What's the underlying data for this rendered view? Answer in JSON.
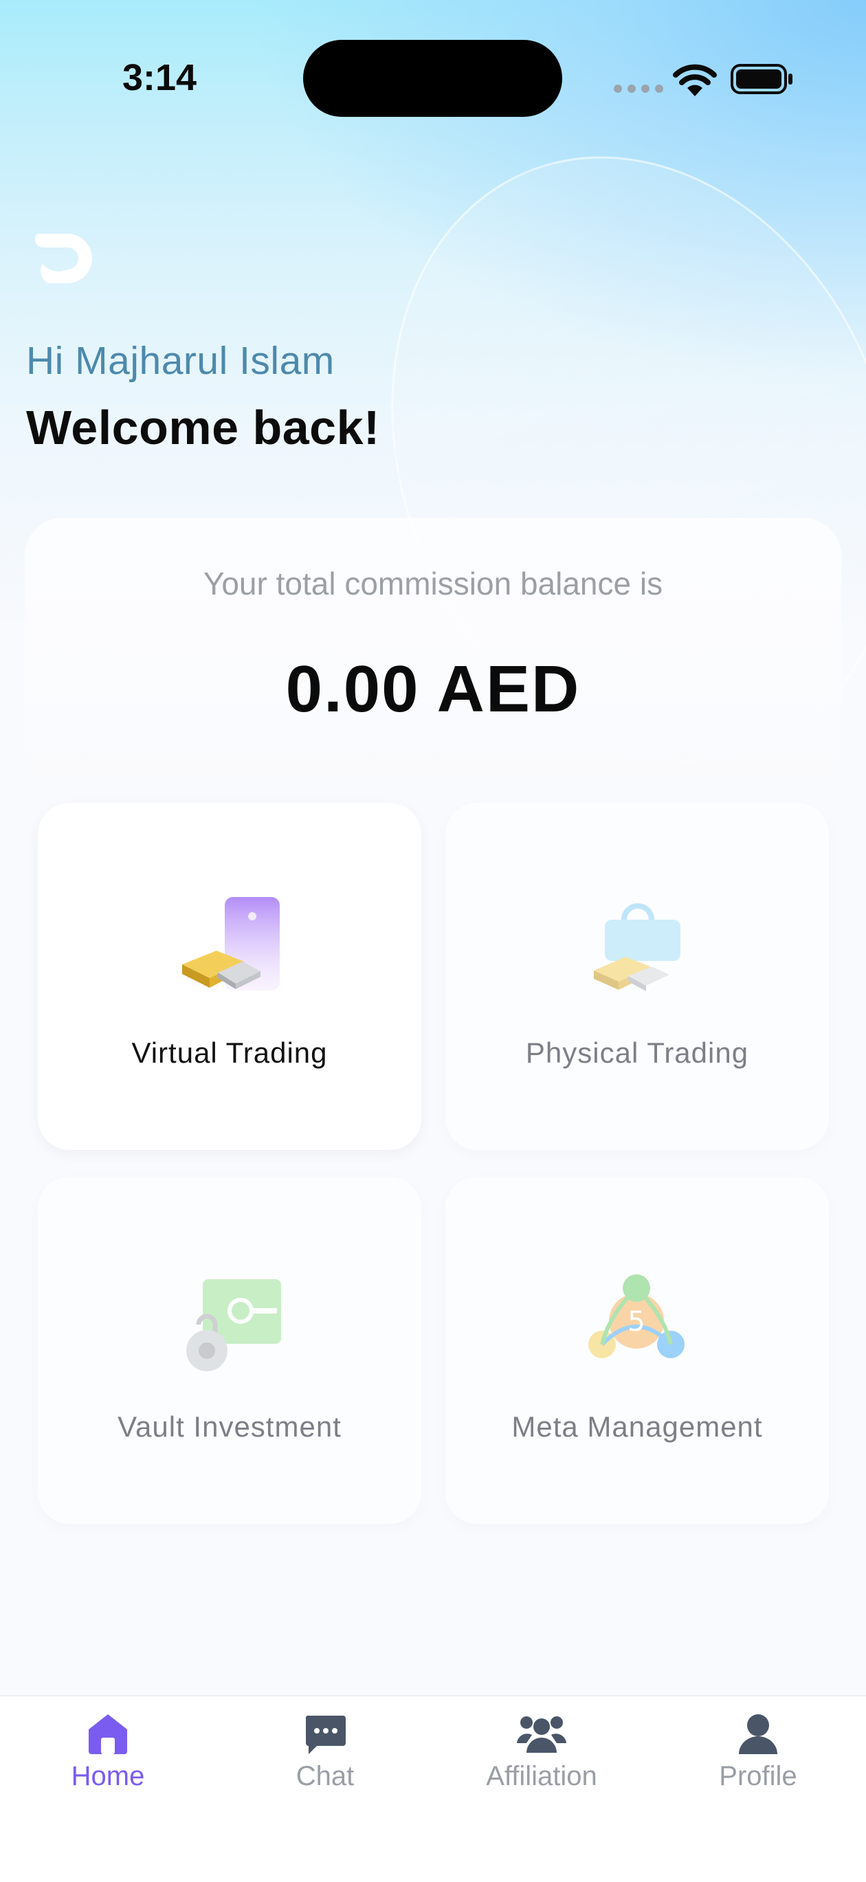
{
  "status_bar": {
    "time": "3:14"
  },
  "header": {
    "greeting": "Hi Majharul Islam",
    "welcome": "Welcome back!"
  },
  "balance": {
    "label": "Your total commission balance is",
    "value": "0.00 AED"
  },
  "services": [
    {
      "label": "Virtual Trading",
      "icon": "virtual-trading-icon",
      "active": true
    },
    {
      "label": "Physical Trading",
      "icon": "physical-trading-icon",
      "active": false
    },
    {
      "label": "Vault Investment",
      "icon": "vault-investment-icon",
      "active": false
    },
    {
      "label": "Meta Management",
      "icon": "meta-management-icon",
      "active": false
    }
  ],
  "nav": {
    "items": [
      {
        "label": "Home",
        "icon": "home-icon",
        "active": true
      },
      {
        "label": "Chat",
        "icon": "chat-icon",
        "active": false
      },
      {
        "label": "Affiliation",
        "icon": "affiliation-icon",
        "active": false
      },
      {
        "label": "Profile",
        "icon": "profile-icon",
        "active": false
      }
    ]
  },
  "colors": {
    "accent": "#7a5cf0",
    "greeting": "#4d89ad",
    "inactive": "#9a9ea5"
  }
}
